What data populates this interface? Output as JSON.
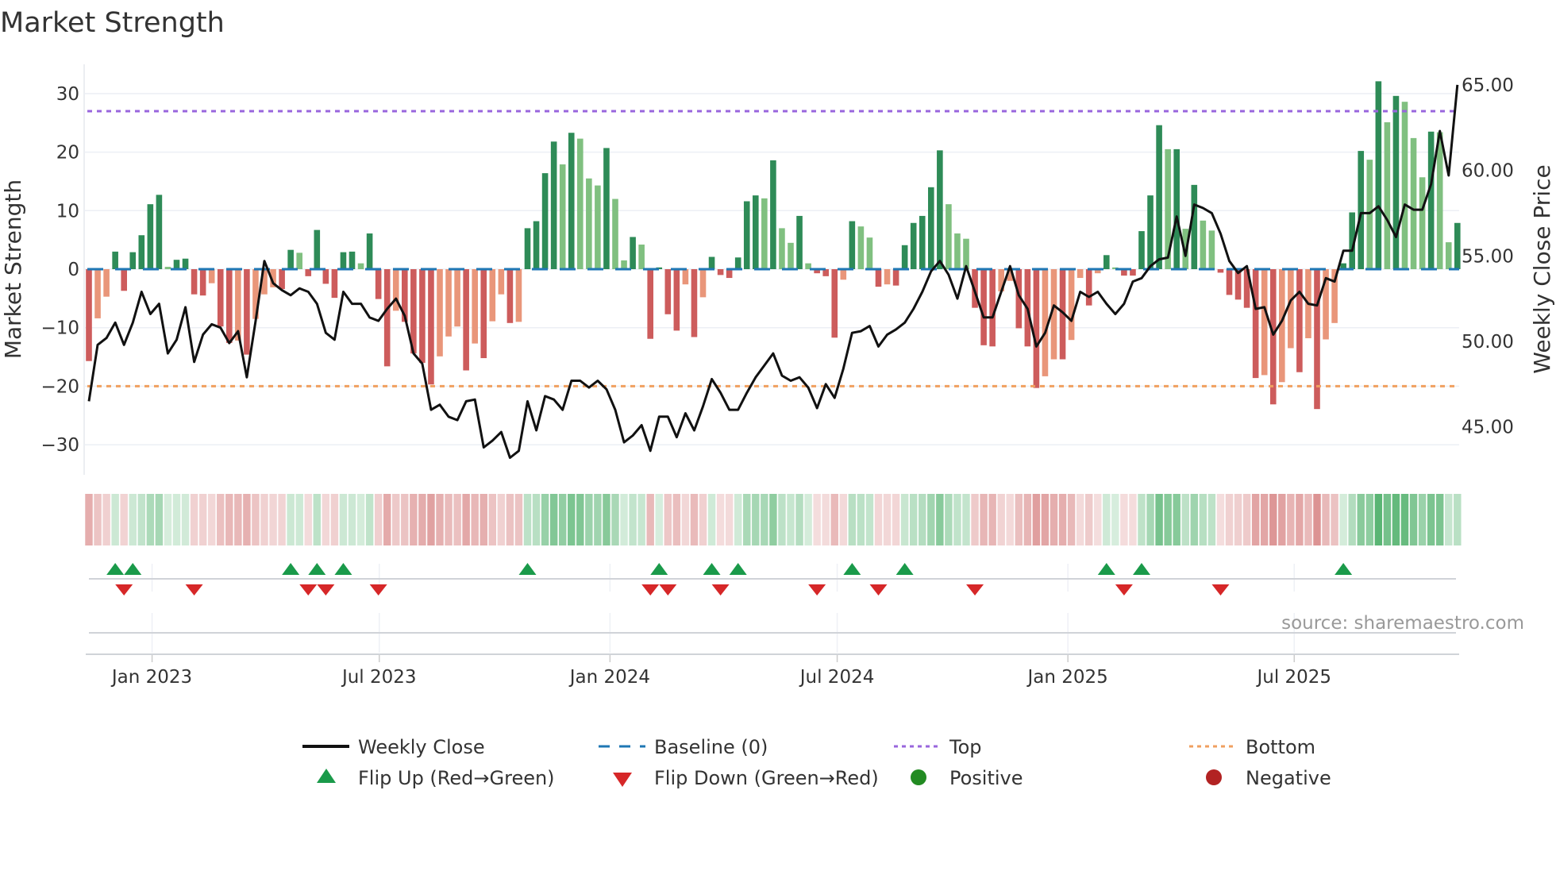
{
  "chart_data": {
    "type": "bar",
    "title": "Market Strength",
    "ylabel": "Market Strength",
    "y2label": "Weekly Close Price",
    "ylim": [
      -35,
      35
    ],
    "y2lim": [
      42.2,
      66.2
    ],
    "yticks": [
      -30,
      -20,
      -10,
      0,
      10,
      20,
      30
    ],
    "y2ticks": [
      "45.00",
      "50.00",
      "55.00",
      "60.00",
      "65.00"
    ],
    "top_level": 27,
    "bottom_level": -20,
    "xticks": [
      {
        "label": "Jan 2023",
        "week": 7.2
      },
      {
        "label": "Jul 2023",
        "week": 33.1
      },
      {
        "label": "Jan 2024",
        "week": 59.4
      },
      {
        "label": "Jul 2024",
        "week": 85.3
      },
      {
        "label": "Jan 2025",
        "week": 111.6
      },
      {
        "label": "Jul 2025",
        "week": 137.4
      }
    ],
    "strength": [
      -15.7,
      -8.4,
      -4.7,
      3.0,
      -3.7,
      2.9,
      5.8,
      11.1,
      12.7,
      0.4,
      1.6,
      1.8,
      -4.3,
      -4.5,
      -2.4,
      -9.8,
      -12.6,
      -12.2,
      -14.6,
      -8.5,
      -4.3,
      -3.1,
      -3.4,
      3.3,
      2.8,
      -1.2,
      6.7,
      -2.5,
      -4.9,
      2.9,
      3.0,
      1.0,
      6.1,
      -5.1,
      -16.6,
      -7.1,
      -9.0,
      -14.4,
      -16.0,
      -19.7,
      -14.9,
      -11.5,
      -9.8,
      -17.3,
      -12.7,
      -15.2,
      -8.9,
      -4.3,
      -9.2,
      -9.0,
      7.0,
      8.2,
      16.4,
      21.8,
      17.9,
      23.3,
      22.3,
      15.5,
      14.3,
      20.7,
      12.0,
      1.5,
      5.5,
      4.2,
      -11.9,
      0.3,
      -7.7,
      -10.5,
      -2.6,
      -11.6,
      -4.8,
      2.1,
      -1.0,
      -1.5,
      2.0,
      11.6,
      12.6,
      12.1,
      18.6,
      7.0,
      4.5,
      9.1,
      1.0,
      -0.7,
      -1.2,
      -11.7,
      -1.8,
      8.2,
      7.3,
      5.4,
      -3.0,
      -2.6,
      -2.8,
      4.1,
      7.9,
      9.1,
      14.0,
      20.3,
      11.1,
      6.1,
      5.2,
      -6.6,
      -13.0,
      -13.2,
      -3.8,
      -2.0,
      -10.1,
      -13.2,
      -20.3,
      -18.3,
      -15.4,
      -15.4,
      -12.1,
      -1.5,
      -6.2,
      -0.7,
      2.4,
      0.3,
      -1.1,
      -1.1,
      6.5,
      12.6,
      24.6,
      20.5,
      20.5,
      6.9,
      14.4,
      8.3,
      6.6,
      -0.6,
      -4.4,
      -5.2,
      -6.6,
      -18.6,
      -18.1,
      -23.1,
      -19.3,
      -13.5,
      -17.6,
      -11.8,
      -23.9,
      -12.0,
      -9.2,
      1.0,
      9.7,
      20.2,
      18.7,
      32.1,
      25.1,
      29.6,
      28.6,
      22.4,
      15.7,
      23.5,
      23.4,
      4.6,
      7.9
    ],
    "weekly_close": [
      46.5,
      49.8,
      50.2,
      51.1,
      49.8,
      51.1,
      52.9,
      51.6,
      52.2,
      49.3,
      50.1,
      52.0,
      48.8,
      50.4,
      51.0,
      50.8,
      49.9,
      50.6,
      47.9,
      51.2,
      54.7,
      53.4,
      53.0,
      52.7,
      53.1,
      52.9,
      52.2,
      50.5,
      50.1,
      52.9,
      52.2,
      52.2,
      51.4,
      51.2,
      51.9,
      52.5,
      51.5,
      49.3,
      48.7,
      46.0,
      46.3,
      45.6,
      45.4,
      46.5,
      46.6,
      43.8,
      44.2,
      44.7,
      43.2,
      43.6,
      46.5,
      44.8,
      46.8,
      46.6,
      46.0,
      47.7,
      47.7,
      47.3,
      47.7,
      47.2,
      46.0,
      44.1,
      44.5,
      45.1,
      43.6,
      45.6,
      45.6,
      44.4,
      45.8,
      44.8,
      46.2,
      47.8,
      47.0,
      46.0,
      46.0,
      47.0,
      47.9,
      48.6,
      49.3,
      48.0,
      47.7,
      47.9,
      47.3,
      46.1,
      47.5,
      46.7,
      48.4,
      50.5,
      50.6,
      50.9,
      49.7,
      50.4,
      50.7,
      51.1,
      51.9,
      52.9,
      54.1,
      54.7,
      53.9,
      52.5,
      54.4,
      52.9,
      51.4,
      51.4,
      52.9,
      54.4,
      52.7,
      51.9,
      49.7,
      50.5,
      52.1,
      51.7,
      51.2,
      52.9,
      52.6,
      52.9,
      52.2,
      51.6,
      52.2,
      53.5,
      53.7,
      54.4,
      54.8,
      54.9,
      57.3,
      55.0,
      58.0,
      57.8,
      57.5,
      56.3,
      54.7,
      54.0,
      54.4,
      51.9,
      52.0,
      50.4,
      51.2,
      52.4,
      52.9,
      52.2,
      52.1,
      53.7,
      53.5,
      55.3,
      55.3,
      57.5,
      57.5,
      57.9,
      57.1,
      56.1,
      58.0,
      57.7,
      57.7,
      59.2,
      62.3,
      59.7,
      65.0
    ],
    "legend": {
      "weekly_close": "Weekly Close",
      "baseline": "Baseline (0)",
      "top": "Top",
      "bottom": "Bottom",
      "flip_up": "Flip Up (Red→Green)",
      "flip_down": "Flip Down (Green→Red)",
      "positive": "Positive",
      "negative": "Negative"
    },
    "source": "source: sharemaestro.com"
  },
  "colors": {
    "pos_rising": "#2e8b57",
    "pos_falling": "#80c080",
    "neg_falling": "#cd5c5c",
    "neg_rising": "#e9967a",
    "baseline": "#1f77b4",
    "top": "#9966dd",
    "bottom": "#f0a060",
    "line": "#111111",
    "flip_up": "#1a9a4a",
    "flip_down": "#d62728",
    "positive": "#228b22",
    "negative": "#b22222"
  }
}
